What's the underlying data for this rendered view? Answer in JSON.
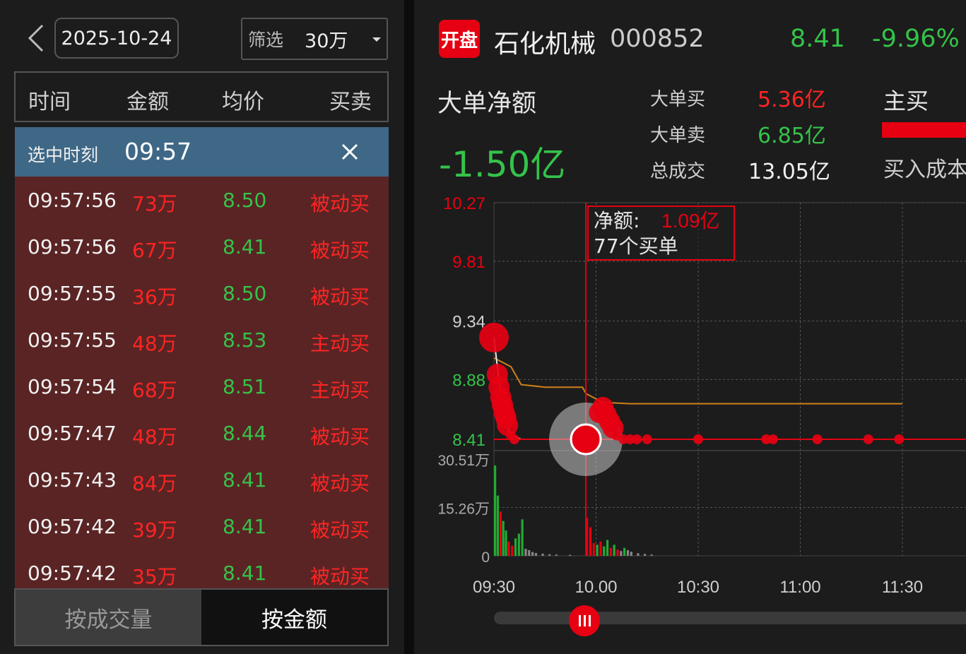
{
  "left": {
    "date": "2025-10-24",
    "filter_label": "筛选",
    "filter_value": "30万",
    "columns": [
      "时间",
      "金额",
      "均价",
      "买卖"
    ],
    "selected_label": "选中时刻",
    "selected_time": "09:57",
    "rows": [
      {
        "time": "09:57:56",
        "amount": "73万",
        "price": "8.50",
        "type": "被动买"
      },
      {
        "time": "09:57:56",
        "amount": "67万",
        "price": "8.41",
        "type": "被动买"
      },
      {
        "time": "09:57:55",
        "amount": "36万",
        "price": "8.50",
        "type": "被动买"
      },
      {
        "time": "09:57:55",
        "amount": "48万",
        "price": "8.53",
        "type": "主动买"
      },
      {
        "time": "09:57:54",
        "amount": "68万",
        "price": "8.51",
        "type": "主动买"
      },
      {
        "time": "09:57:47",
        "amount": "48万",
        "price": "8.44",
        "type": "被动买"
      },
      {
        "time": "09:57:43",
        "amount": "84万",
        "price": "8.41",
        "type": "被动买"
      },
      {
        "time": "09:57:42",
        "amount": "39万",
        "price": "8.41",
        "type": "被动买"
      },
      {
        "time": "09:57:42",
        "amount": "35万",
        "price": "8.41",
        "type": "被动买"
      }
    ],
    "tabs": {
      "by_volume": "按成交量",
      "by_amount": "按金额"
    }
  },
  "right": {
    "badge": "开盘",
    "stock_name": "石化机械",
    "stock_code": "000852",
    "price": "8.41",
    "change": "-9.96%",
    "net_label": "大单净额",
    "net_value": "-1.50亿",
    "stats": {
      "big_buy_label": "大单买",
      "big_buy_value": "5.36亿",
      "big_sell_label": "大单卖",
      "big_sell_value": "6.85亿",
      "total_label": "总成交",
      "total_value": "13.05亿"
    },
    "main_buy": "主买",
    "cost_label": "买入成本",
    "tooltip": {
      "net_label": "净额:",
      "net_value": "1.09亿",
      "count": "77个买单"
    }
  },
  "chart_data": {
    "type": "line",
    "price_axis_ticks": [
      "10.27",
      "9.81",
      "9.34",
      "8.88",
      "8.41"
    ],
    "price_ylim": [
      8.41,
      10.27
    ],
    "volume_axis_ticks": [
      "30.51万",
      "15.26万",
      "0"
    ],
    "volume_ylim": [
      0,
      30.51
    ],
    "x_ticks": [
      "09:30",
      "10.00",
      "10:30",
      "11:00",
      "11:30"
    ],
    "series": [
      {
        "values": [
          [
            0,
            9.21
          ],
          [
            1,
            8.98
          ],
          [
            2,
            8.78
          ],
          [
            3,
            8.6
          ],
          [
            4,
            8.52
          ],
          [
            5,
            8.44
          ],
          [
            8,
            8.41
          ],
          [
            15,
            8.41
          ],
          [
            30,
            8.41
          ],
          [
            45,
            8.41
          ],
          [
            60,
            8.41
          ],
          [
            75,
            8.41
          ],
          [
            90,
            8.41
          ],
          [
            120,
            8.41
          ]
        ]
      },
      {
        "values": [
          [
            0,
            9.05
          ],
          [
            5,
            8.98
          ],
          [
            8,
            8.84
          ],
          [
            15,
            8.82
          ],
          [
            26,
            8.82
          ],
          [
            27,
            8.77
          ],
          [
            32,
            8.7
          ],
          [
            40,
            8.69
          ],
          [
            60,
            8.69
          ],
          [
            90,
            8.69
          ],
          [
            120,
            8.69
          ]
        ]
      }
    ],
    "big_orders": [
      {
        "t": 0,
        "p": 9.21,
        "size": "large"
      },
      {
        "t": 1,
        "p": 8.92
      },
      {
        "t": 1.5,
        "p": 8.82
      },
      {
        "t": 2,
        "p": 8.74
      },
      {
        "t": 2.5,
        "p": 8.68
      },
      {
        "t": 3,
        "p": 8.62
      },
      {
        "t": 3.5,
        "p": 8.58
      },
      {
        "t": 4,
        "p": 8.52
      },
      {
        "t": 5,
        "p": 8.44
      },
      {
        "t": 6,
        "p": 8.41
      },
      {
        "t": 27,
        "p": 8.41,
        "size": "selected"
      },
      {
        "t": 31,
        "p": 8.62
      },
      {
        "t": 32,
        "p": 8.66
      },
      {
        "t": 33,
        "p": 8.6
      },
      {
        "t": 34,
        "p": 8.55
      },
      {
        "t": 35,
        "p": 8.5
      },
      {
        "t": 36,
        "p": 8.44
      },
      {
        "t": 38,
        "p": 8.41
      },
      {
        "t": 40,
        "p": 8.41
      },
      {
        "t": 42,
        "p": 8.41
      },
      {
        "t": 45,
        "p": 8.41
      },
      {
        "t": 60,
        "p": 8.41
      },
      {
        "t": 80,
        "p": 8.41
      },
      {
        "t": 82,
        "p": 8.41
      },
      {
        "t": 95,
        "p": 8.41
      },
      {
        "t": 110,
        "p": 8.41
      },
      {
        "t": 119,
        "p": 8.41
      }
    ],
    "volume_bars": [
      {
        "t": 0,
        "v": 28.5,
        "c": "g"
      },
      {
        "t": 0.8,
        "v": 19,
        "c": "g"
      },
      {
        "t": 1.6,
        "v": 14,
        "c": "r"
      },
      {
        "t": 2.4,
        "v": 11,
        "c": "g"
      },
      {
        "t": 3.2,
        "v": 8,
        "c": "g"
      },
      {
        "t": 4,
        "v": 4.5,
        "c": "r"
      },
      {
        "t": 5,
        "v": 3.2,
        "c": "r"
      },
      {
        "t": 6,
        "v": 5.5,
        "c": "g"
      },
      {
        "t": 7,
        "v": 7,
        "c": "g"
      },
      {
        "t": 8,
        "v": 11.5,
        "c": "g"
      },
      {
        "t": 9,
        "v": 2.2,
        "c": "k"
      },
      {
        "t": 10,
        "v": 1.8,
        "c": "k"
      },
      {
        "t": 11,
        "v": 1.2,
        "c": "k"
      },
      {
        "t": 12,
        "v": 0.9,
        "c": "k"
      },
      {
        "t": 14,
        "v": 0.7,
        "c": "k"
      },
      {
        "t": 16,
        "v": 0.5,
        "c": "k"
      },
      {
        "t": 18,
        "v": 0.4,
        "c": "k"
      },
      {
        "t": 22,
        "v": 0.3,
        "c": "k"
      },
      {
        "t": 27,
        "v": 12,
        "c": "r"
      },
      {
        "t": 28,
        "v": 9,
        "c": "r"
      },
      {
        "t": 29,
        "v": 4,
        "c": "r"
      },
      {
        "t": 30,
        "v": 3.5,
        "c": "g"
      },
      {
        "t": 31,
        "v": 4.5,
        "c": "r"
      },
      {
        "t": 32,
        "v": 3,
        "c": "g"
      },
      {
        "t": 33,
        "v": 5,
        "c": "g"
      },
      {
        "t": 34,
        "v": 2.5,
        "c": "r"
      },
      {
        "t": 35,
        "v": 3.5,
        "c": "g"
      },
      {
        "t": 36,
        "v": 2,
        "c": "r"
      },
      {
        "t": 37,
        "v": 1.5,
        "c": "k"
      },
      {
        "t": 38,
        "v": 2.5,
        "c": "g"
      },
      {
        "t": 39,
        "v": 1.8,
        "c": "k"
      },
      {
        "t": 40,
        "v": 1.3,
        "c": "k"
      },
      {
        "t": 42,
        "v": 0.8,
        "c": "k"
      },
      {
        "t": 44,
        "v": 0.6,
        "c": "k"
      },
      {
        "t": 46,
        "v": 0.4,
        "c": "k"
      }
    ],
    "selected_t": 27,
    "colors": {
      "price_line": "#e8e8e8",
      "avg_line": "#d08018",
      "up": "#e60012",
      "down": "#22aa33",
      "neutral": "#888888",
      "grid": "#555555"
    }
  }
}
